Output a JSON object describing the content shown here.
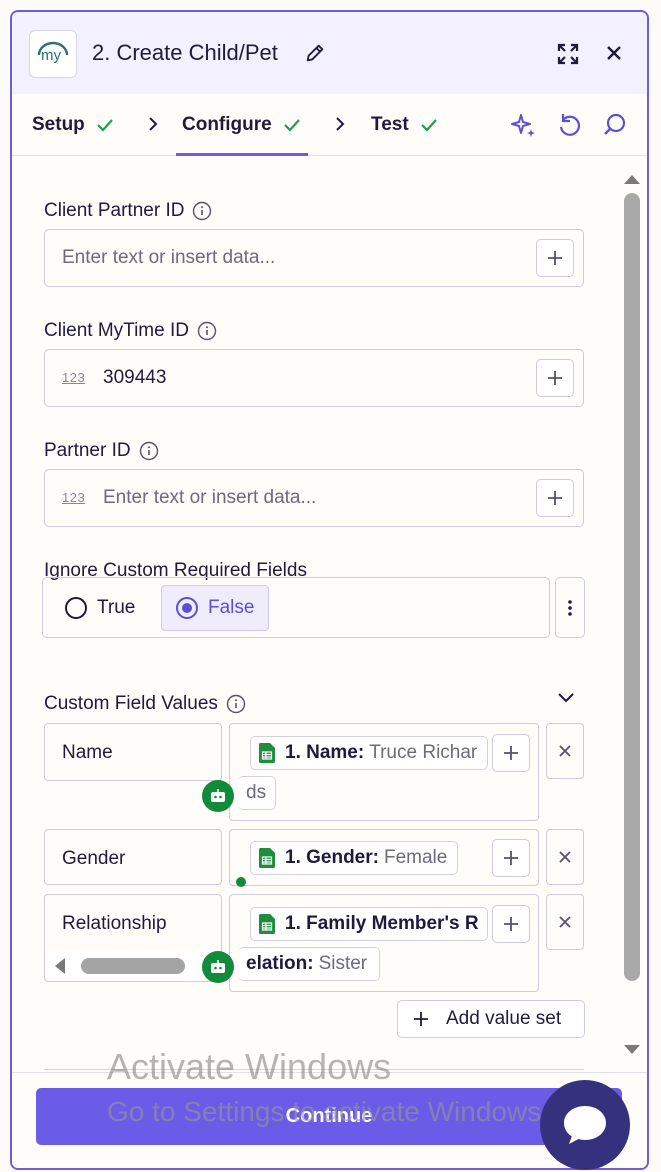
{
  "header": {
    "logo_text": "my",
    "title": "2. Create Child/Pet",
    "icons": {
      "edit": "pencil-icon",
      "expand": "expand-icon",
      "close": "close-icon"
    }
  },
  "tabs": [
    {
      "label": "Setup",
      "done": true
    },
    {
      "label": "Configure",
      "done": true,
      "active": true
    },
    {
      "label": "Test",
      "done": true
    }
  ],
  "tools": [
    "sparkle-icon",
    "undo-icon",
    "search-icon"
  ],
  "fields": {
    "client_partner_id": {
      "label": "Client Partner ID",
      "placeholder": "Enter text or insert data..."
    },
    "client_mytime_id": {
      "label": "Client MyTime ID",
      "type_badge": "123",
      "value": "309443"
    },
    "partner_id": {
      "label": "Partner ID",
      "type_badge": "123",
      "placeholder": "Enter text or insert data..."
    },
    "ignore_custom": {
      "label": "Ignore Custom Required Fields",
      "options": [
        "True",
        "False"
      ],
      "selected": "False"
    }
  },
  "custom_fields": {
    "label": "Custom Field Values",
    "rows": [
      {
        "key": "Name",
        "pill_label": "1. Name:",
        "pill_value": "Truce Richar",
        "overflow": "ds"
      },
      {
        "key": "Gender",
        "pill_label": "1. Gender:",
        "pill_value": "Female"
      },
      {
        "key": "Relationship",
        "pill_label": "1. Family Member's R",
        "pill_value": "",
        "overflow_label": "elation:",
        "overflow_value": "Sister"
      }
    ],
    "add_label": "Add value set"
  },
  "footer": {
    "continue_label": "Continue"
  },
  "watermark": {
    "line1": "Activate Windows",
    "line2": "Go to Settings to activate Windows."
  },
  "colors": {
    "accent": "#6b5ce7",
    "border": "#6b5ed8",
    "check": "#1f9d55",
    "sheets": "#1e8e3e",
    "bot": "#128a3b",
    "chat": "#36317d"
  }
}
